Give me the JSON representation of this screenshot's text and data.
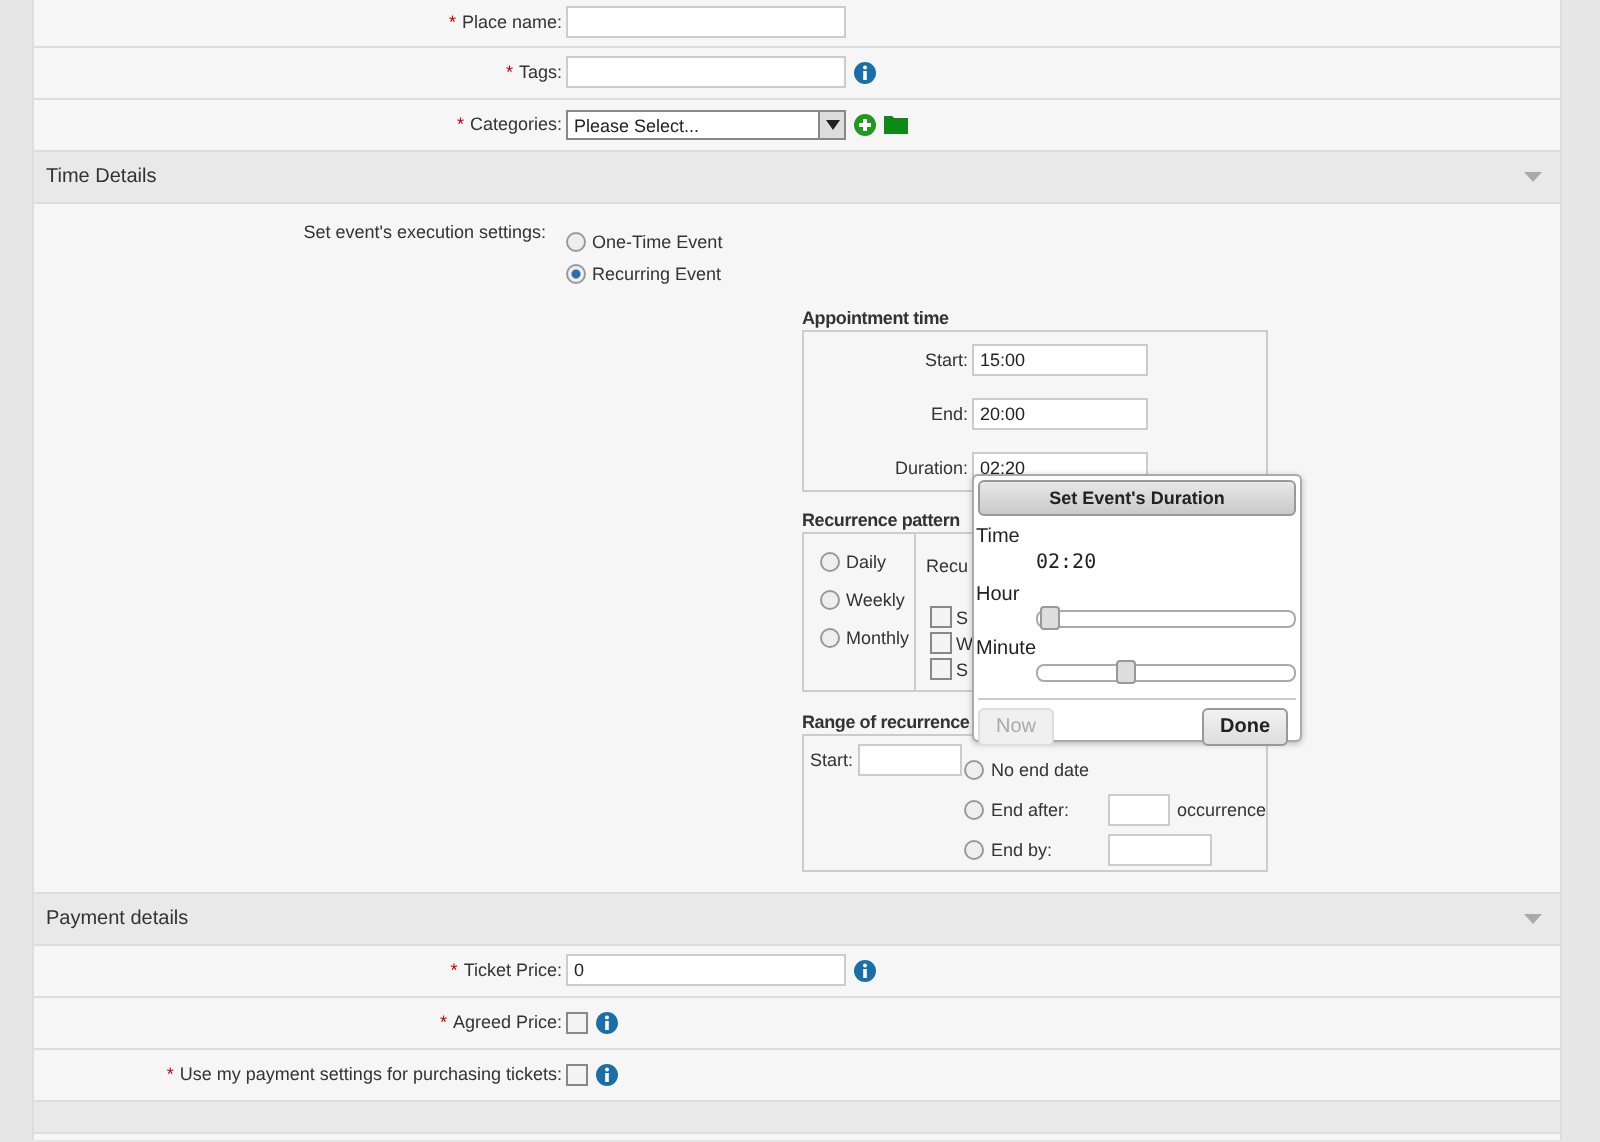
{
  "top_fields": [
    {
      "kind": "text",
      "marker": "*",
      "label": "Place name:",
      "info": false
    },
    {
      "kind": "text",
      "marker": "*",
      "label": "Tags:",
      "info": true
    },
    {
      "kind": "select",
      "marker": "*",
      "label": "Categories:",
      "info": false,
      "value": "Please Select..."
    }
  ],
  "time_details": {
    "title": "Time Details",
    "expanded": true,
    "execution_label": "Set event's execution settings:",
    "execution_options": [
      {
        "label": "One-Time Event",
        "selected": false
      },
      {
        "label": "Recurring Event",
        "selected": true
      }
    ],
    "appointment": {
      "title": "Appointment time",
      "rows": [
        {
          "label": "Start:",
          "value": "15:00"
        },
        {
          "label": "End:",
          "value": "20:00"
        },
        {
          "label": "Duration:",
          "value": "02:20"
        }
      ]
    },
    "recurrence": {
      "title": "Recurrence pattern",
      "options": [
        {
          "label": "Daily",
          "selected": false
        },
        {
          "label": "Weekly",
          "selected": false
        },
        {
          "label": "Monthly",
          "selected": false
        }
      ],
      "detail_text": "Recu",
      "days": [
        {
          "label": "S",
          "checked": false
        },
        {
          "label": "W",
          "checked": false
        },
        {
          "label": "S",
          "checked": false
        }
      ]
    },
    "range": {
      "title": "Range of recurrence",
      "start_label": "Start:",
      "end_options": [
        {
          "kind": "plain",
          "label": "No end date",
          "selected": false
        },
        {
          "kind": "count",
          "label": "End after:",
          "suffix": "occurrence",
          "selected": false
        },
        {
          "kind": "date",
          "label": "End by:",
          "selected": false
        }
      ]
    },
    "popup": {
      "title": "Set Event's Duration",
      "time_label": "Time",
      "time_value": "02:20",
      "sliders": [
        {
          "label": "Hour",
          "level": 0.05
        },
        {
          "label": "Minute",
          "level": 0.34
        }
      ],
      "buttons": [
        {
          "label": "Now",
          "disabled": true
        },
        {
          "label": "Done",
          "disabled": false
        }
      ]
    }
  },
  "payment": {
    "title": "Payment details",
    "expanded": true,
    "fields": [
      {
        "kind": "text",
        "marker": "*",
        "label": "Ticket Price:",
        "info": true,
        "value": "0"
      },
      {
        "kind": "checkbox",
        "marker": "*",
        "label": "Agreed Price:",
        "info": true,
        "checked": false
      },
      {
        "kind": "checkbox",
        "marker": "*",
        "label": "Use my payment settings for purchasing tickets:",
        "info": true,
        "checked": false
      }
    ]
  }
}
